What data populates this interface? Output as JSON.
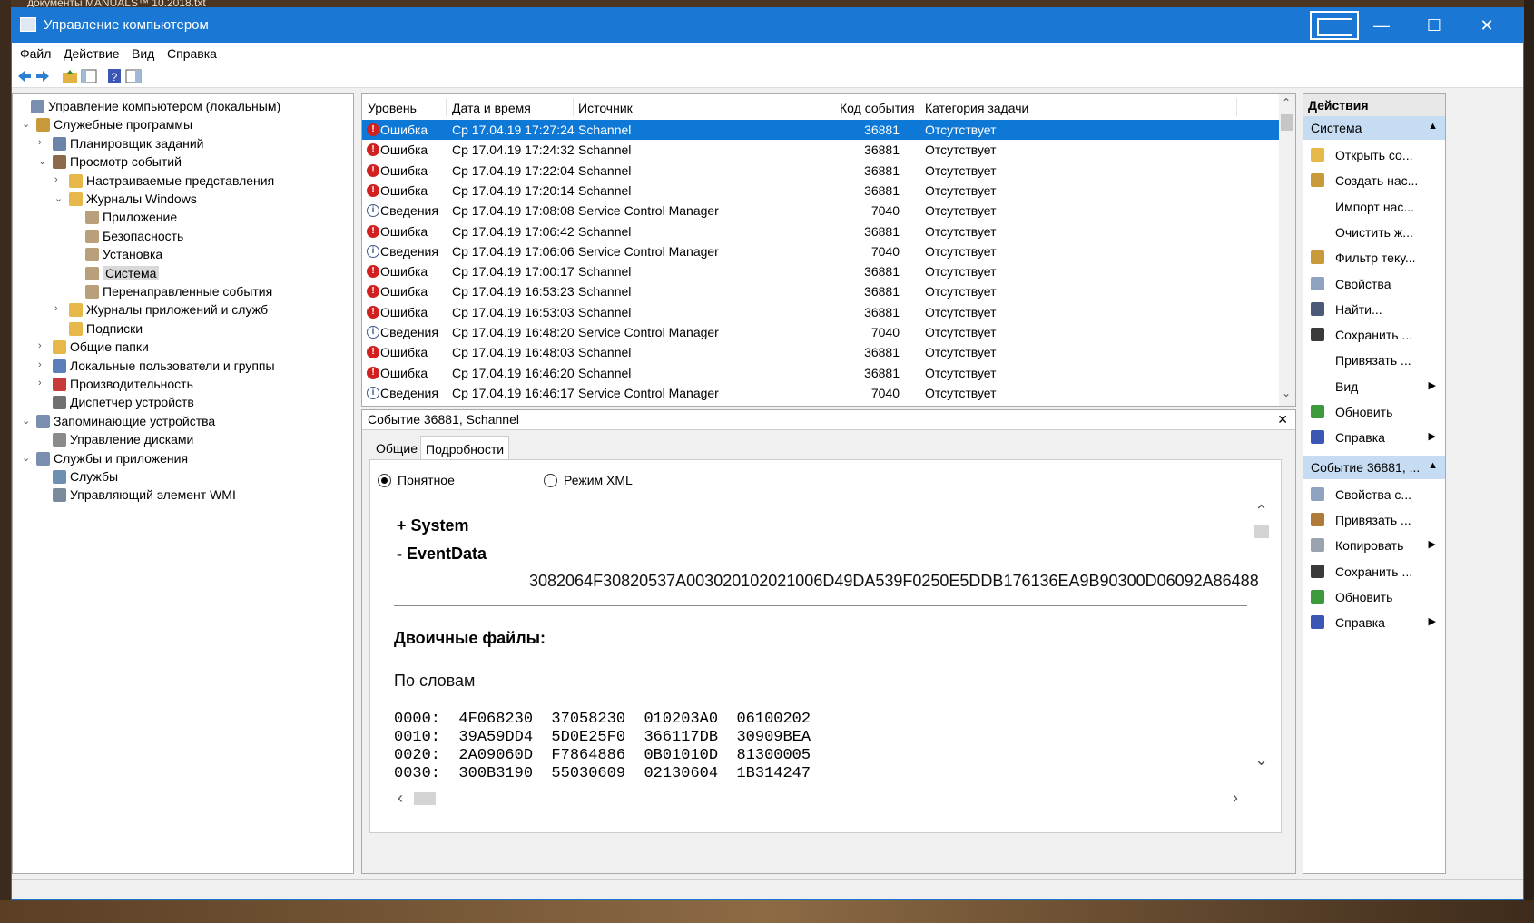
{
  "desktop": {
    "top_text": "документы    MANUALS™                    10.2018.txt"
  },
  "window": {
    "title": "Управление компьютером",
    "minimize": "—",
    "maximize": "☐",
    "close": "✕"
  },
  "menu": [
    "Файл",
    "Действие",
    "Вид",
    "Справка"
  ],
  "tree": [
    {
      "label": "Управление компьютером (локальным)",
      "level": 0,
      "expand": "",
      "icon": "computer-icon"
    },
    {
      "label": "Служебные программы",
      "level": 1,
      "expand": "⌄",
      "icon": "tools-icon"
    },
    {
      "label": "Планировщик заданий",
      "level": 2,
      "expand": "›",
      "icon": "clock-icon"
    },
    {
      "label": "Просмотр событий",
      "level": 2,
      "expand": "⌄",
      "icon": "event-viewer-icon"
    },
    {
      "label": "Настраиваемые представления",
      "level": 3,
      "expand": "›",
      "icon": "folder-icon"
    },
    {
      "label": "Журналы Windows",
      "level": 3,
      "expand": "⌄",
      "icon": "folder-icon"
    },
    {
      "label": "Приложение",
      "level": 4,
      "expand": "",
      "icon": "log-icon"
    },
    {
      "label": "Безопасность",
      "level": 4,
      "expand": "",
      "icon": "log-icon"
    },
    {
      "label": "Установка",
      "level": 4,
      "expand": "",
      "icon": "log-icon"
    },
    {
      "label": "Система",
      "level": 4,
      "expand": "",
      "icon": "log-icon",
      "selected": true
    },
    {
      "label": "Перенаправленные события",
      "level": 4,
      "expand": "",
      "icon": "log-icon"
    },
    {
      "label": "Журналы приложений и служб",
      "level": 3,
      "expand": "›",
      "icon": "folder-icon"
    },
    {
      "label": "Подписки",
      "level": 3,
      "expand": "",
      "icon": "folder-icon"
    },
    {
      "label": "Общие папки",
      "level": 2,
      "expand": "›",
      "icon": "shared-folder-icon"
    },
    {
      "label": "Локальные пользователи и группы",
      "level": 2,
      "expand": "›",
      "icon": "users-icon"
    },
    {
      "label": "Производительность",
      "level": 2,
      "expand": "›",
      "icon": "performance-icon"
    },
    {
      "label": "Диспетчер устройств",
      "level": 2,
      "expand": "",
      "icon": "device-manager-icon"
    },
    {
      "label": "Запоминающие устройства",
      "level": 1,
      "expand": "⌄",
      "icon": "storage-icon"
    },
    {
      "label": "Управление дисками",
      "level": 2,
      "expand": "",
      "icon": "disk-icon"
    },
    {
      "label": "Службы и приложения",
      "level": 1,
      "expand": "⌄",
      "icon": "services-icon"
    },
    {
      "label": "Службы",
      "level": 2,
      "expand": "",
      "icon": "gear-icon"
    },
    {
      "label": "Управляющий элемент WMI",
      "level": 2,
      "expand": "",
      "icon": "wmi-icon"
    }
  ],
  "list": {
    "headers": [
      "Уровень",
      "Дата и время",
      "Источник",
      "Код события",
      "Категория задачи"
    ],
    "rows": [
      {
        "level": "Ошибка",
        "type": "error",
        "date": "Ср 17.04.19 17:27:24",
        "source": "Schannel",
        "code": "36881",
        "category": "Отсутствует",
        "selected": true
      },
      {
        "level": "Ошибка",
        "type": "error",
        "date": "Ср 17.04.19 17:24:32",
        "source": "Schannel",
        "code": "36881",
        "category": "Отсутствует"
      },
      {
        "level": "Ошибка",
        "type": "error",
        "date": "Ср 17.04.19 17:22:04",
        "source": "Schannel",
        "code": "36881",
        "category": "Отсутствует"
      },
      {
        "level": "Ошибка",
        "type": "error",
        "date": "Ср 17.04.19 17:20:14",
        "source": "Schannel",
        "code": "36881",
        "category": "Отсутствует"
      },
      {
        "level": "Сведения",
        "type": "info",
        "date": "Ср 17.04.19 17:08:08",
        "source": "Service Control Manager",
        "code": "7040",
        "category": "Отсутствует"
      },
      {
        "level": "Ошибка",
        "type": "error",
        "date": "Ср 17.04.19 17:06:42",
        "source": "Schannel",
        "code": "36881",
        "category": "Отсутствует"
      },
      {
        "level": "Сведения",
        "type": "info",
        "date": "Ср 17.04.19 17:06:06",
        "source": "Service Control Manager",
        "code": "7040",
        "category": "Отсутствует"
      },
      {
        "level": "Ошибка",
        "type": "error",
        "date": "Ср 17.04.19 17:00:17",
        "source": "Schannel",
        "code": "36881",
        "category": "Отсутствует"
      },
      {
        "level": "Ошибка",
        "type": "error",
        "date": "Ср 17.04.19 16:53:23",
        "source": "Schannel",
        "code": "36881",
        "category": "Отсутствует"
      },
      {
        "level": "Ошибка",
        "type": "error",
        "date": "Ср 17.04.19 16:53:03",
        "source": "Schannel",
        "code": "36881",
        "category": "Отсутствует"
      },
      {
        "level": "Сведения",
        "type": "info",
        "date": "Ср 17.04.19 16:48:20",
        "source": "Service Control Manager",
        "code": "7040",
        "category": "Отсутствует"
      },
      {
        "level": "Ошибка",
        "type": "error",
        "date": "Ср 17.04.19 16:48:03",
        "source": "Schannel",
        "code": "36881",
        "category": "Отсутствует"
      },
      {
        "level": "Ошибка",
        "type": "error",
        "date": "Ср 17.04.19 16:46:20",
        "source": "Schannel",
        "code": "36881",
        "category": "Отсутствует"
      },
      {
        "level": "Сведения",
        "type": "info",
        "date": "Ср 17.04.19 16:46:17",
        "source": "Service Control Manager",
        "code": "7040",
        "category": "Отсутствует"
      }
    ]
  },
  "detail": {
    "title": "Событие 36881, Schannel",
    "close": "✕",
    "tabs": [
      "Общие",
      "Подробности"
    ],
    "radio_friendly": "Понятное",
    "radio_xml": "Режим XML",
    "system": "+ System",
    "eventdata": "-  EventData",
    "eventdata_value": "3082064F30820537A003020102021006D49DA539F0250E5DDB176136EA9B90300D06092A86488",
    "binary_title": "Двоичные файлы:",
    "by_words": "По словам",
    "hex_lines": [
      "0000:  4F068230  37058230  010203A0  06100202",
      "0010:  39A59DD4  5D0E25F0  366117DB  30909BEA",
      "0020:  2A09060D  F7864886  0B01010D  81300005",
      "0030:  300B3190  55030609  02130604  1B314247"
    ]
  },
  "actions": {
    "header": "Действия",
    "section1": "Система",
    "items1": [
      {
        "label": "Открыть со...",
        "icon": "open-folder-icon"
      },
      {
        "label": "Создать нас...",
        "icon": "filter-icon"
      },
      {
        "label": "Импорт нас...",
        "icon": ""
      },
      {
        "label": "Очистить ж...",
        "icon": ""
      },
      {
        "label": "Фильтр теку...",
        "icon": "filter-icon"
      },
      {
        "label": "Свойства",
        "icon": "properties-icon"
      },
      {
        "label": "Найти...",
        "icon": "binoculars-icon"
      },
      {
        "label": "Сохранить ...",
        "icon": "save-icon"
      },
      {
        "label": "Привязать ...",
        "icon": ""
      },
      {
        "label": "Вид",
        "icon": "",
        "submenu": "▶"
      },
      {
        "label": "Обновить",
        "icon": "refresh-icon"
      },
      {
        "label": "Справка",
        "icon": "help-icon",
        "submenu": "▶"
      }
    ],
    "section2": "Событие 36881, ...",
    "items2": [
      {
        "label": "Свойства с...",
        "icon": "properties-icon"
      },
      {
        "label": "Привязать ...",
        "icon": "attach-icon"
      },
      {
        "label": "Копировать",
        "icon": "copy-icon",
        "submenu": "▶"
      },
      {
        "label": "Сохранить ...",
        "icon": "save-icon"
      },
      {
        "label": "Обновить",
        "icon": "refresh-icon"
      },
      {
        "label": "Справка",
        "icon": "help-icon",
        "submenu": "▶"
      }
    ]
  }
}
